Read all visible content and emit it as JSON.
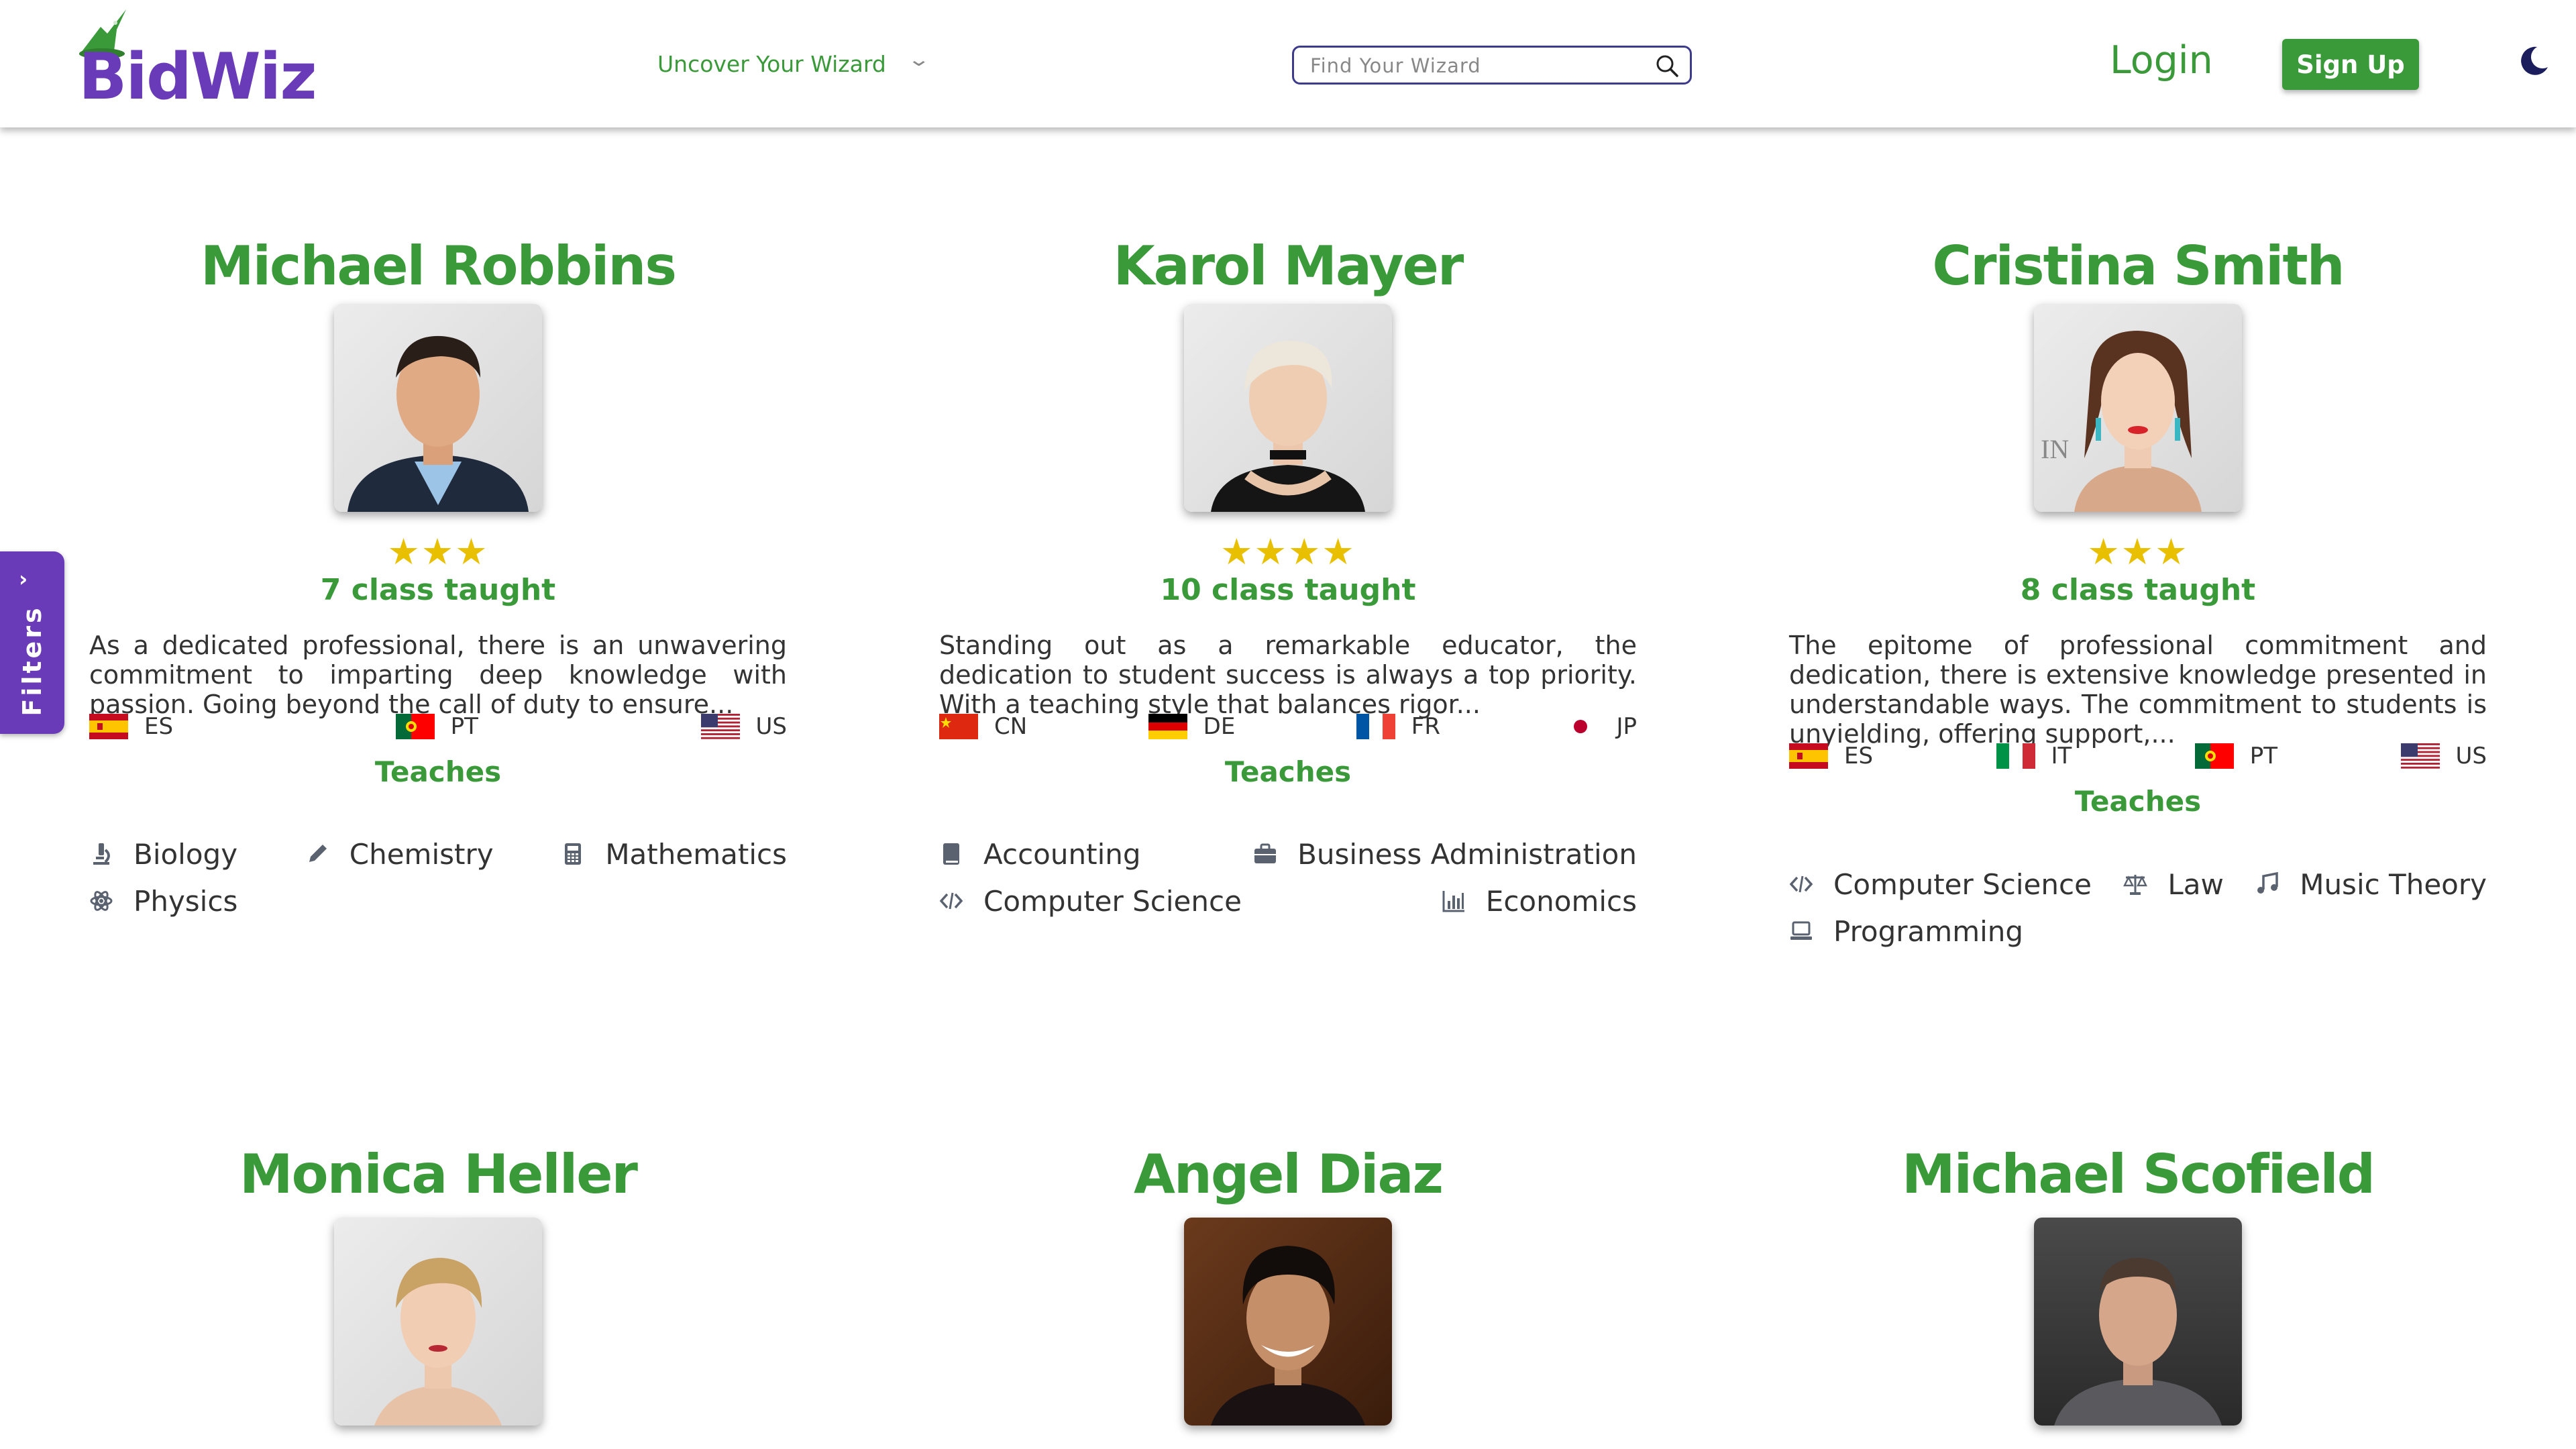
{
  "brand": {
    "name": "BidWiz"
  },
  "nav": {
    "uncover": "Uncover Your Wizard"
  },
  "search": {
    "placeholder": "Find Your Wizard",
    "value": ""
  },
  "auth": {
    "login": "Login",
    "signup": "Sign Up"
  },
  "filters": {
    "label": "Filters"
  },
  "labels": {
    "teaches": "Teaches"
  },
  "colors": {
    "brand_purple": "#6a3bb8",
    "brand_green": "#3a9a3a",
    "star": "#e8c000"
  },
  "tutors": [
    {
      "name": "Michael Robbins",
      "stars": "★★★",
      "taught": "7 class taught",
      "bio": "As a dedicated professional, there is an unwavering commitment to imparting deep knowledge with passion. Going beyond the call of duty to ensure...",
      "languages": [
        {
          "code": "ES",
          "flag": "es"
        },
        {
          "code": "PT",
          "flag": "pt"
        },
        {
          "code": "US",
          "flag": "us"
        }
      ],
      "subjects": [
        [
          {
            "name": "Biology",
            "icon": "microscope-icon"
          },
          {
            "name": "Chemistry",
            "icon": "eyedropper-icon"
          },
          {
            "name": "Mathematics",
            "icon": "calculator-icon"
          }
        ],
        [
          {
            "name": "Physics",
            "icon": "atom-icon"
          }
        ]
      ]
    },
    {
      "name": "Karol Mayer",
      "stars": "★★★★",
      "taught": "10 class taught",
      "bio": "Standing out as a remarkable educator, the dedication to student success is always a top priority. With a teaching style that balances rigor...",
      "languages": [
        {
          "code": "CN",
          "flag": "cn"
        },
        {
          "code": "DE",
          "flag": "de"
        },
        {
          "code": "FR",
          "flag": "fr"
        },
        {
          "code": "JP",
          "flag": "jp"
        }
      ],
      "subjects": [
        [
          {
            "name": "Accounting",
            "icon": "book-icon"
          },
          {
            "name": "Business Administration",
            "icon": "briefcase-icon"
          }
        ],
        [
          {
            "name": "Computer Science",
            "icon": "code-icon"
          },
          {
            "name": "Economics",
            "icon": "bar-chart-icon"
          }
        ]
      ]
    },
    {
      "name": "Cristina Smith",
      "stars": "★★★",
      "taught": "8 class taught",
      "bio": "The epitome of professional commitment and dedication, there is extensive knowledge presented in understandable ways. The commitment to students is unyielding, offering support,...",
      "languages": [
        {
          "code": "ES",
          "flag": "es"
        },
        {
          "code": "IT",
          "flag": "it"
        },
        {
          "code": "PT",
          "flag": "pt"
        },
        {
          "code": "US",
          "flag": "us"
        }
      ],
      "subjects": [
        [
          {
            "name": "Computer Science",
            "icon": "code-icon"
          },
          {
            "name": "Law",
            "icon": "scale-icon"
          },
          {
            "name": "Music Theory",
            "icon": "music-icon"
          }
        ],
        [
          {
            "name": "Programming",
            "icon": "laptop-icon"
          }
        ]
      ]
    },
    {
      "name": "Monica Heller"
    },
    {
      "name": "Angel Diaz"
    },
    {
      "name": "Michael Scofield"
    }
  ]
}
